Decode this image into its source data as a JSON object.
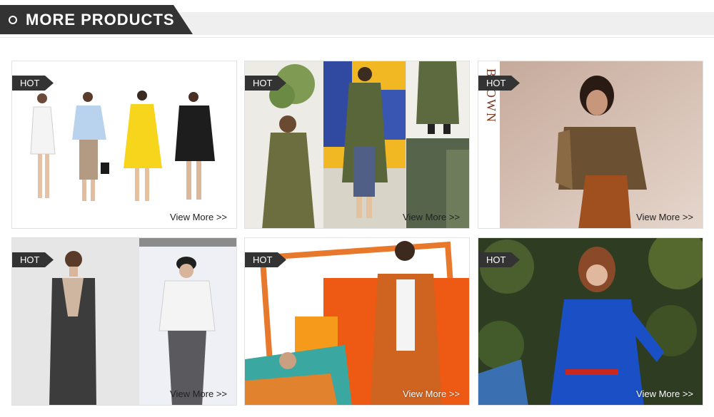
{
  "section": {
    "title": "MORE PRODUCTS"
  },
  "products": [
    {
      "badge": "HOT",
      "link": "View More >>",
      "image": "models-in-white-blue-yellow-black-outfits"
    },
    {
      "badge": "HOT",
      "link": "View More >>",
      "image": "olive-trench-coat-collage"
    },
    {
      "badge": "HOT",
      "link": "View More >>",
      "image": "woman-striped-shirt-brown-trousers",
      "image_text": "BROWN"
    },
    {
      "badge": "HOT",
      "link": "View More >>",
      "image": "grey-jumpsuit-and-white-shirt-runway"
    },
    {
      "badge": "HOT",
      "link": "View More >>",
      "image": "orange-utility-jacket-collage"
    },
    {
      "badge": "HOT",
      "link": "View More >>",
      "image": "woman-blue-dress-red-belt"
    }
  ],
  "colors": {
    "badge_bg": "#333333",
    "header_bg": "#333333",
    "header_band": "#efefef"
  }
}
